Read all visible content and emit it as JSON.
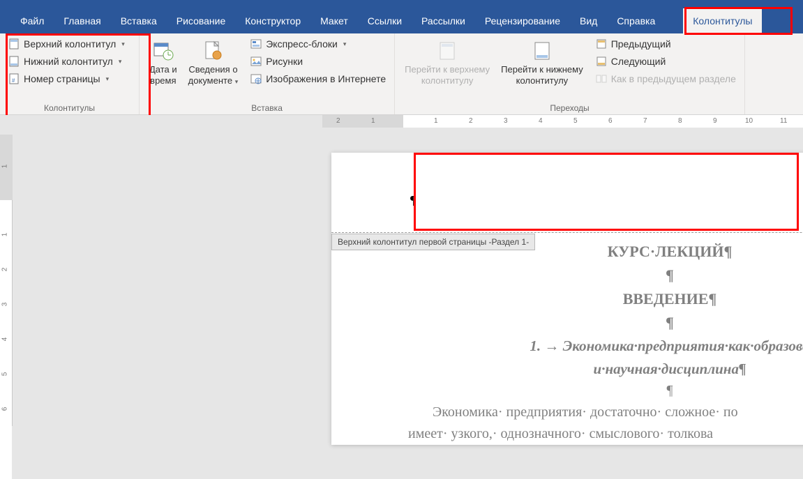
{
  "tabs": {
    "file": "Файл",
    "home": "Главная",
    "insert": "Вставка",
    "draw": "Рисование",
    "design": "Конструктор",
    "layout": "Макет",
    "references": "Ссылки",
    "mailings": "Рассылки",
    "review": "Рецензирование",
    "view": "Вид",
    "help": "Справка",
    "headers": "Колонтитулы"
  },
  "groups": {
    "hf": {
      "label": "Колонтитулы",
      "header": "Верхний колонтитул",
      "footer": "Нижний колонтитул",
      "pagenum": "Номер страницы"
    },
    "insert": {
      "label": "Вставка",
      "datetime_l1": "Дата и",
      "datetime_l2": "время",
      "docinfo_l1": "Сведения о",
      "docinfo_l2": "документе",
      "quickparts": "Экспресс-блоки",
      "pictures": "Рисунки",
      "online_pics": "Изображения в Интернете"
    },
    "nav": {
      "label": "Переходы",
      "gotoheader_l1": "Перейти к верхнему",
      "gotoheader_l2": "колонтитулу",
      "gotofooter_l1": "Перейти к нижнему",
      "gotofooter_l2": "колонтитулу",
      "prev": "Предыдущий",
      "next": "Следующий",
      "linkprev": "Как в предыдущем разделе"
    }
  },
  "header_tag": "Верхний колонтитул первой страницы -Раздел 1-",
  "doc": {
    "t1": "КУРС·ЛЕКЦИЙ¶",
    "empty": "¶",
    "t2": "ВВЕДЕНИЕ¶",
    "sub_l1": "1.  →  Экономика·предприятия·как·образова",
    "sub_l2": "и·научная·дисциплина¶",
    "body_l1": "Экономика· предприятия· достаточно· сложное· по",
    "body_l2": "имеет· узкого,· однозначного· смыслового· толкова"
  },
  "ruler": {
    "nums_left": [
      "2",
      "1"
    ],
    "nums_right": [
      "1",
      "2",
      "3",
      "4",
      "5",
      "6",
      "7",
      "8",
      "9",
      "10",
      "11"
    ]
  },
  "vruler": [
    "1",
    "1",
    "2",
    "3",
    "4",
    "5",
    "6"
  ]
}
